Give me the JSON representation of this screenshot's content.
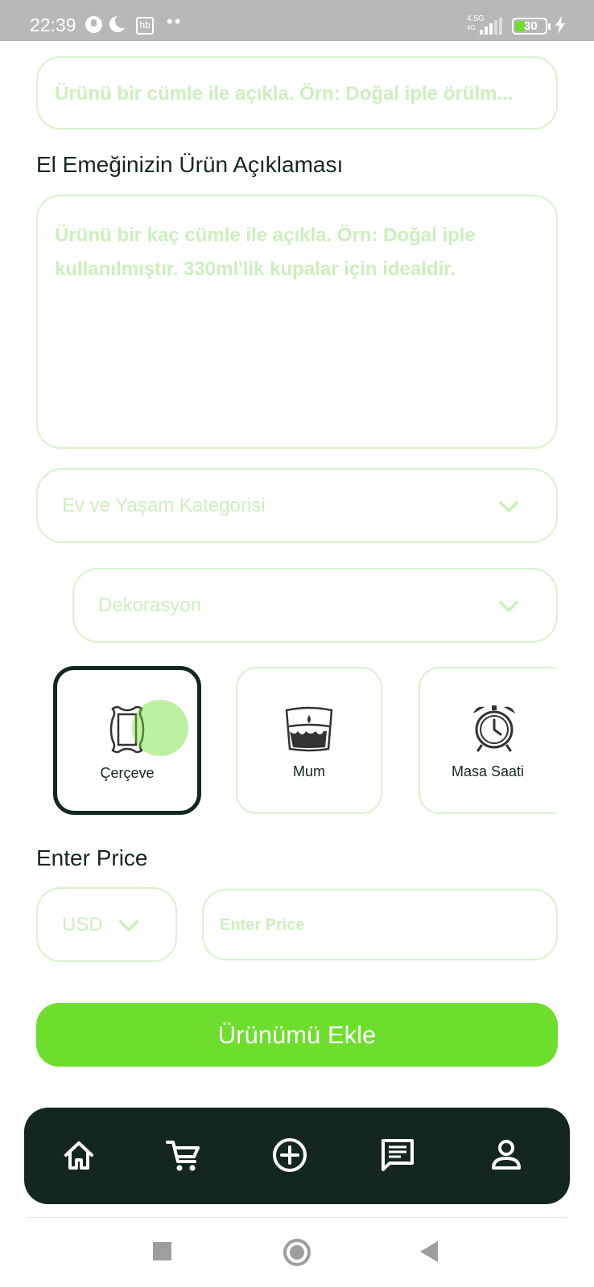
{
  "status_bar": {
    "time": "22:39",
    "hb": "hb",
    "dots": "••",
    "network_top": "4.5G",
    "network_bottom": "4G",
    "battery": "30"
  },
  "form": {
    "short_desc_placeholder": "Ürünü bir cümle ile açıkla. Örn: Doğal iple örülm...",
    "description_label": "El Emeğinizin Ürün Açıklaması",
    "description_placeholder": "Ürünü bir kaç cümle ile açıkla. Örn: Doğal iple kullanılmıştır. 330ml'lik kupalar için idealdir.",
    "category_select": "Ev ve Yaşam Kategorisi",
    "subcategory_select": "Dekorasyon",
    "categories": [
      {
        "label": "Çerçeve",
        "icon": "frame-icon",
        "selected": true
      },
      {
        "label": "Mum",
        "icon": "candle-icon",
        "selected": false
      },
      {
        "label": "Masa Saati",
        "icon": "alarm-clock-icon",
        "selected": false
      }
    ],
    "price_label": "Enter Price",
    "currency": "USD",
    "price_placeholder": "Enter Price",
    "submit_label": "Ürünümü Ekle"
  },
  "bottom_nav": {
    "items": [
      {
        "icon": "home-icon"
      },
      {
        "icon": "cart-icon"
      },
      {
        "icon": "add-circle-icon"
      },
      {
        "icon": "message-icon"
      },
      {
        "icon": "profile-icon"
      }
    ]
  },
  "colors": {
    "accent": "#6ede2e",
    "dark": "#14271f",
    "field_border": "#d9f2cd",
    "placeholder": "#ccefbe"
  }
}
